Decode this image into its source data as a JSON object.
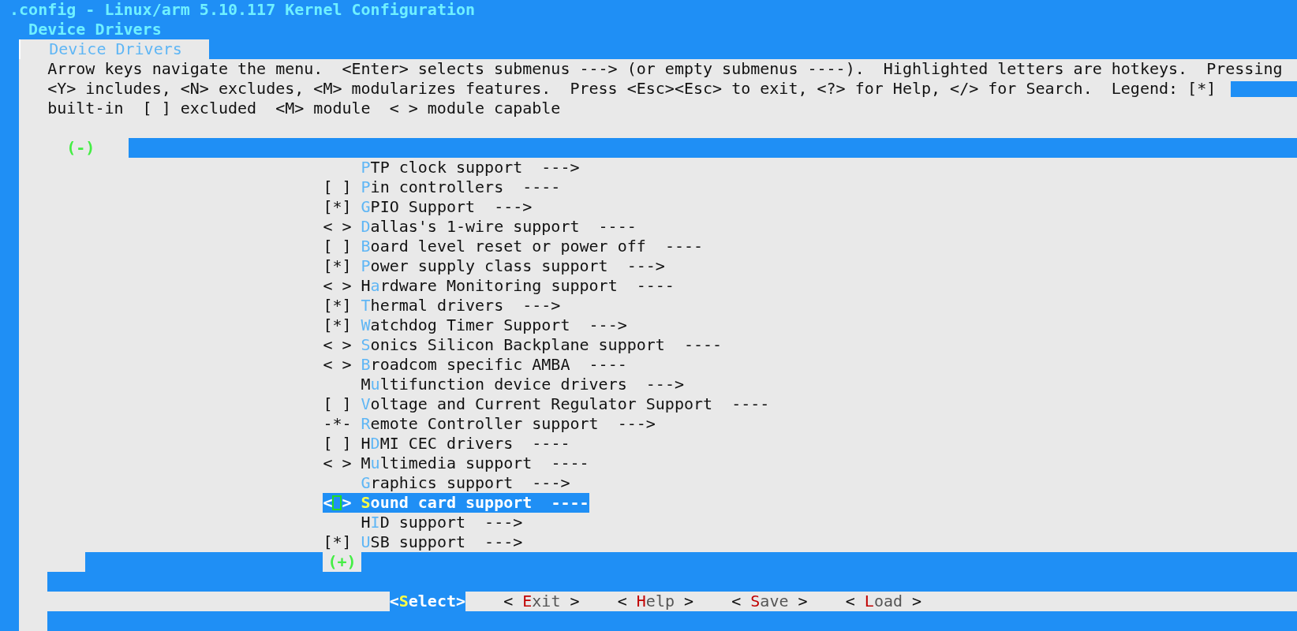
{
  "window": {
    "title": ".config - Linux/arm 5.10.117 Kernel Configuration"
  },
  "breadcrumb": "Device Drivers",
  "dialog": {
    "title": "Device Drivers",
    "help_lines": [
      "Arrow keys navigate the menu.  <Enter> selects submenus ---> (or empty submenus ----).  Highlighted letters are hotkeys.  Pressing",
      "<Y> includes, <N> excludes, <M> modularizes features.  Press <Esc><Esc> to exit, <?> for Help, </> for Search.  Legend: [*]",
      "built-in  [ ] excluded  <M> module  < > module capable"
    ],
    "scroll_up": "(-)",
    "items": [
      {
        "hotkey": "P",
        "after": "TP clock support",
        "suffix": "--->",
        "selected": false
      },
      {
        "prefix": "[ ]",
        "hotkey": "P",
        "after": "in controllers",
        "suffix": "----",
        "selected": false
      },
      {
        "prefix": "[*]",
        "hotkey": "G",
        "after": "PIO Support",
        "suffix": "--->",
        "selected": false
      },
      {
        "prefix": "< >",
        "hotkey": "D",
        "after": "allas's 1-wire support",
        "suffix": "----",
        "selected": false
      },
      {
        "prefix": "[ ]",
        "hotkey": "B",
        "after": "oard level reset or power off",
        "suffix": "----",
        "selected": false
      },
      {
        "prefix": "[*]",
        "hotkey": "P",
        "after": "ower supply class support",
        "suffix": "--->",
        "selected": false
      },
      {
        "prefix": "< >",
        "before": "H",
        "hotkey": "a",
        "after": "rdware Monitoring support",
        "suffix": "----",
        "selected": false
      },
      {
        "prefix": "[*]",
        "hotkey": "T",
        "after": "hermal drivers",
        "suffix": "--->",
        "selected": false
      },
      {
        "prefix": "[*]",
        "hotkey": "W",
        "after": "atchdog Timer Support",
        "suffix": "--->",
        "selected": false
      },
      {
        "prefix": "< >",
        "hotkey": "S",
        "after": "onics Silicon Backplane support",
        "suffix": "----",
        "selected": false
      },
      {
        "prefix": "< >",
        "hotkey": "B",
        "after": "roadcom specific AMBA",
        "suffix": "----",
        "selected": false
      },
      {
        "before": "M",
        "hotkey": "u",
        "after": "ltifunction device drivers",
        "suffix": "--->",
        "selected": false
      },
      {
        "prefix": "[ ]",
        "hotkey": "V",
        "after": "oltage and Current Regulator Support",
        "suffix": "----",
        "selected": false
      },
      {
        "prefix": "-*-",
        "hotkey": "R",
        "after": "emote Controller support",
        "suffix": "--->",
        "selected": false
      },
      {
        "prefix": "[ ]",
        "before": "H",
        "hotkey": "D",
        "after": "MI CEC drivers",
        "suffix": "----",
        "selected": false
      },
      {
        "prefix": "< >",
        "before": "M",
        "hotkey": "u",
        "after": "ltimedia support",
        "suffix": "----",
        "selected": false
      },
      {
        "hotkey": "G",
        "after": "raphics support",
        "suffix": "--->",
        "selected": false
      },
      {
        "prefix": "< >",
        "hotkey": "S",
        "after": "ound card support",
        "suffix": "----",
        "selected": true
      },
      {
        "before": "H",
        "hotkey": "I",
        "after": "D support",
        "suffix": "--->",
        "selected": false
      },
      {
        "prefix": "[*]",
        "hotkey": "U",
        "after": "SB support",
        "suffix": "--->",
        "selected": false
      }
    ],
    "scroll_down": "(+)",
    "buttons": [
      {
        "open": "<",
        "hotkey": "S",
        "rest": "elect",
        "close": ">",
        "selected": true
      },
      {
        "open": "< ",
        "hotkey": "E",
        "rest": "xit",
        "close": " >",
        "selected": false
      },
      {
        "open": "< ",
        "hotkey": "H",
        "rest": "elp",
        "close": " >",
        "selected": false
      },
      {
        "open": "< ",
        "hotkey": "S",
        "rest": "ave",
        "close": " >",
        "selected": false
      },
      {
        "open": "< ",
        "hotkey": "L",
        "rest": "oad",
        "close": " >",
        "selected": false
      }
    ]
  }
}
